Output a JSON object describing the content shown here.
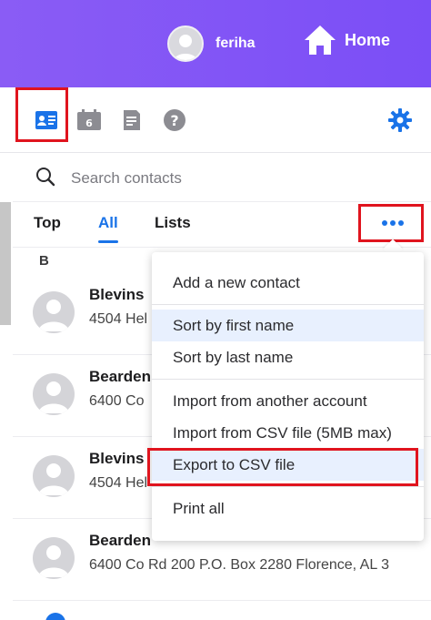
{
  "header": {
    "user_name": "feriha",
    "home_label": "Home"
  },
  "toolbar": {
    "calendar_badge": "6",
    "icons": [
      "contacts-card-icon",
      "calendar-icon",
      "notepad-icon",
      "help-icon",
      "gear-icon"
    ]
  },
  "search": {
    "placeholder": "Search contacts"
  },
  "tabs": [
    {
      "label": "Top",
      "active": false
    },
    {
      "label": "All",
      "active": true
    },
    {
      "label": "Lists",
      "active": false
    }
  ],
  "section_letter": "B",
  "contacts": [
    {
      "name": "Blevins",
      "address": "4504 Hel"
    },
    {
      "name": "Bearden",
      "address": "6400 Co"
    },
    {
      "name": "Blevins",
      "address": "4504 Hel"
    },
    {
      "name": "Bearden",
      "address": "6400 Co Rd 200 P.O. Box 2280 Florence, AL 3"
    }
  ],
  "menu": {
    "add_contact": "Add a new contact",
    "sort_first": "Sort by first name",
    "sort_last": "Sort by last name",
    "import_account": "Import from another account",
    "import_csv": "Import from CSV file (5MB max)",
    "export_csv": "Export to CSV file",
    "print_all": "Print all"
  },
  "colors": {
    "header_bg": "#7b4ef6",
    "accent": "#1a73e8",
    "highlight_box": "#e0141e"
  }
}
